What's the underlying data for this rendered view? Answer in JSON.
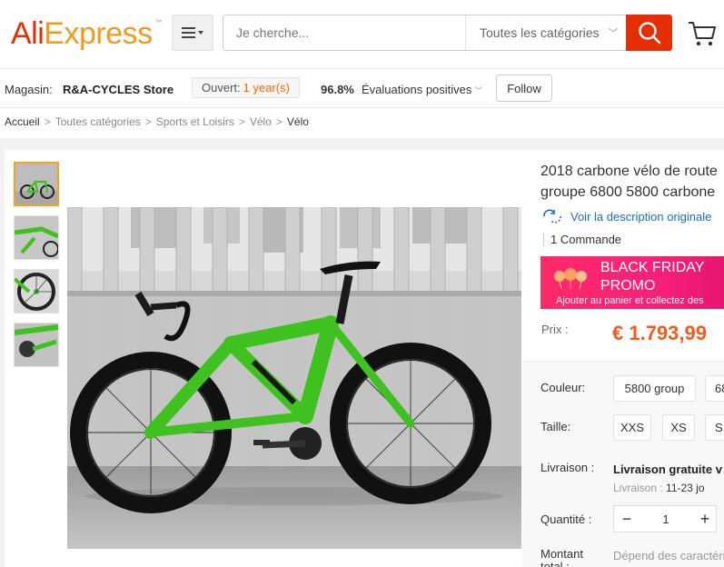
{
  "header": {
    "logo_ali": "Ali",
    "logo_express": "Express",
    "logo_tm": "™",
    "search_placeholder": "Je cherche...",
    "category_select": "Toutes les catégories"
  },
  "store": {
    "label": "Magasin:",
    "name": "R&A-CYCLES Store",
    "opened_label": "Ouvert:",
    "opened_value": "1 year(s)",
    "rating_percent": "96.8%",
    "rating_label": "Évaluations positives",
    "follow_label": "Follow"
  },
  "breadcrumb": [
    "Accueil",
    "Toutes catégories",
    "Sports et Loisirs",
    "Vélo",
    "Vélo"
  ],
  "product": {
    "title_line1": "2018 carbone vélo de route",
    "title_line2": "groupe 6800 5800 carbone",
    "translate_link": "Voir la description originale",
    "orders": "1 Commande",
    "promo_title1": "BLACK FRIDAY",
    "promo_title2": "PROMO",
    "promo_sub": "Ajouter au panier et collectez des",
    "price_label": "Prix :",
    "price": "€ 1.793,99",
    "color_label": "Couleur:",
    "colors": [
      "5800 group",
      "68"
    ],
    "size_label": "Taille:",
    "sizes": [
      "XXS",
      "XS",
      "S"
    ],
    "shipping_label": "Livraison :",
    "shipping_value": "Livraison gratuite v",
    "shipping_sub_label": "Livraison :",
    "shipping_sub_value": "11-23 jo",
    "quantity_label": "Quantité :",
    "quantity_value": "1",
    "total_label": "Montant total :",
    "total_value": "Dépend des caractéri"
  },
  "colors": {
    "brand_red": "#e62e04",
    "brand_orange": "#f29a1f",
    "price": "#f55a1a",
    "link": "#1a6bcc",
    "promo": "#ff2a68"
  }
}
